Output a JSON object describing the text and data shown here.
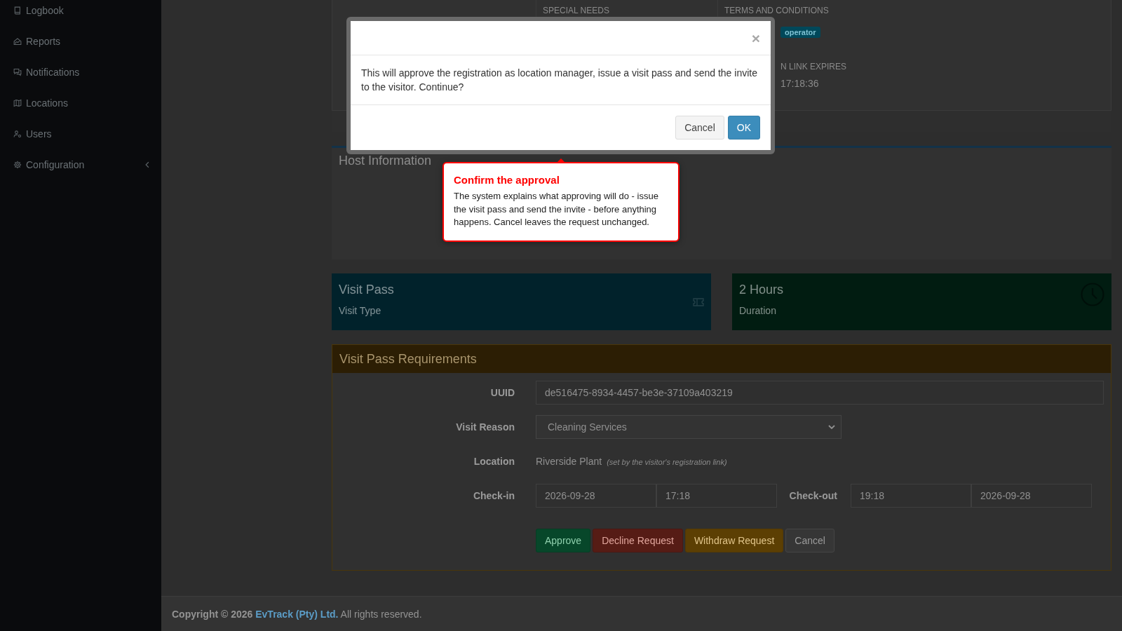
{
  "sidebar": {
    "items": [
      {
        "label": "Logbook",
        "kind": "link"
      },
      {
        "label": "Reports",
        "kind": "link"
      },
      {
        "label": "Notifications",
        "kind": "link"
      },
      {
        "label": "Locations",
        "kind": "link"
      },
      {
        "label": "Users",
        "kind": "link"
      },
      {
        "label": "Configuration",
        "kind": "submenu"
      }
    ]
  },
  "visitor_details": {
    "column_2_heading": "SPECIAL NEEDS",
    "column_3_heading": "TERMS AND CONDITIONS",
    "badge": "operator",
    "link_expiry": {
      "label": "N LINK EXPIRES",
      "value": "17:18:36"
    }
  },
  "host_information": {
    "title": "Host Information"
  },
  "stat_boxes": [
    {
      "title": "Visit Pass",
      "subtitle": "Visit Type",
      "color": "#01222b"
    },
    {
      "title": "2 Hours",
      "subtitle": "Duration",
      "color": "#011c11"
    }
  ],
  "requirements": {
    "title": "Visit Pass Requirements",
    "fields": [
      {
        "kind": "text",
        "label": "UUID",
        "value": "de516475-8934-4457-be3e-37109a403219"
      },
      {
        "kind": "select",
        "label": "Visit Reason",
        "value": "Cleaning Services"
      },
      {
        "kind": "static",
        "label": "Location",
        "value": "Riverside Plant",
        "note": "(set by the visitor's registration link)"
      },
      {
        "kind": "range",
        "label": "Check-in",
        "inputs": [
          "2026-09-28",
          "17:18"
        ],
        "end_label": "Check-out",
        "end_inputs": [
          "19:18",
          "2026-09-28"
        ]
      }
    ],
    "buttons": [
      {
        "label": "Approve",
        "kind": "success",
        "color": "#07472a"
      },
      {
        "label": "Decline Request",
        "kind": "danger",
        "color": "#561c15"
      },
      {
        "label": "Withdraw Request",
        "kind": "warning",
        "color": "#5c3f03"
      },
      {
        "label": "Cancel",
        "kind": "default",
        "color": "#363636"
      }
    ]
  },
  "footer": {
    "copyright": "Copyright © 2026",
    "company_link": "EvTrack (Pty) Ltd.",
    "rights": "All rights reserved."
  },
  "modal": {
    "close": "×",
    "message": "This will approve the registration as location manager, issue a visit pass and send the invite to the visitor. Continue?",
    "buttons": [
      {
        "label": "Cancel",
        "kind": "default"
      },
      {
        "label": "OK",
        "kind": "primary"
      }
    ]
  },
  "callout": {
    "title": "Confirm the approval",
    "text": "The system explains what approving will do - issue the visit pass and send the invite - before anything happens. Cancel leaves the request unchanged."
  }
}
